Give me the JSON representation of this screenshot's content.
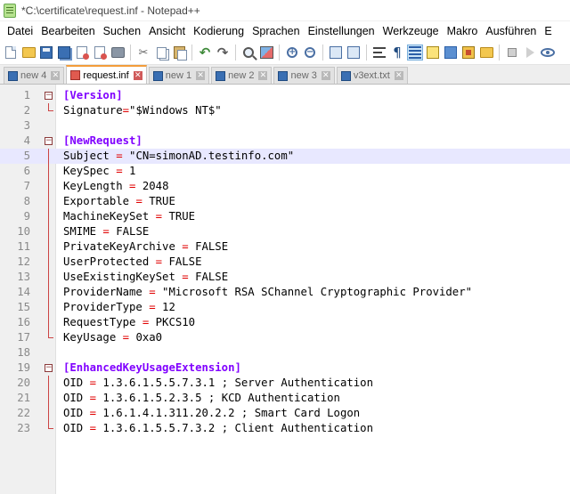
{
  "window": {
    "title": "*C:\\certificate\\request.inf - Notepad++"
  },
  "menu": [
    "Datei",
    "Bearbeiten",
    "Suchen",
    "Ansicht",
    "Kodierung",
    "Sprachen",
    "Einstellungen",
    "Werkzeuge",
    "Makro",
    "Ausführen",
    "E"
  ],
  "toolbar": {
    "icons": [
      "new-file-icon",
      "open-folder-icon",
      "save-icon",
      "save-all-icon",
      "close-icon",
      "close-all-icon",
      "print-icon",
      "cut-icon",
      "copy-icon",
      "paste-icon",
      "undo-icon",
      "redo-icon",
      "find-icon",
      "replace-icon",
      "zoom-in-icon",
      "zoom-out-icon",
      "sync-vertical-icon",
      "sync-horizontal-icon",
      "word-wrap-icon",
      "show-all-characters-icon",
      "indent-guide-icon",
      "user-defined-language-icon",
      "doc-map-icon",
      "function-list-icon",
      "folder-as-workspace-icon",
      "record-macro-icon",
      "play-macro-icon",
      "monitoring-icon"
    ]
  },
  "tabs": [
    {
      "label": "new 4",
      "active": false,
      "modified": false
    },
    {
      "label": "request.inf",
      "active": true,
      "modified": true
    },
    {
      "label": "new 1",
      "active": false,
      "modified": false
    },
    {
      "label": "new 2",
      "active": false,
      "modified": false
    },
    {
      "label": "new 3",
      "active": false,
      "modified": false
    },
    {
      "label": "v3ext.txt",
      "active": false,
      "modified": false
    }
  ],
  "editor": {
    "lines": [
      {
        "num": "1",
        "section": "[Version]"
      },
      {
        "num": "2",
        "key": "Signature",
        "op": "=",
        "val": "\"$Windows NT$\""
      },
      {
        "num": "3"
      },
      {
        "num": "4",
        "section": "[NewRequest]"
      },
      {
        "num": "5",
        "key": "Subject ",
        "op": "=",
        "val": " \"CN=simonAD.testinfo.com\"",
        "current": true
      },
      {
        "num": "6",
        "key": "KeySpec ",
        "op": "=",
        "val": " 1"
      },
      {
        "num": "7",
        "key": "KeyLength ",
        "op": "=",
        "val": " 2048"
      },
      {
        "num": "8",
        "key": "Exportable ",
        "op": "=",
        "val": " TRUE"
      },
      {
        "num": "9",
        "key": "MachineKeySet ",
        "op": "=",
        "val": " TRUE"
      },
      {
        "num": "10",
        "key": "SMIME ",
        "op": "=",
        "val": " FALSE"
      },
      {
        "num": "11",
        "key": "PrivateKeyArchive ",
        "op": "=",
        "val": " FALSE"
      },
      {
        "num": "12",
        "key": "UserProtected ",
        "op": "=",
        "val": " FALSE"
      },
      {
        "num": "13",
        "key": "UseExistingKeySet ",
        "op": "=",
        "val": " FALSE"
      },
      {
        "num": "14",
        "key": "ProviderName ",
        "op": "=",
        "val": " \"Microsoft RSA SChannel Cryptographic Provider\""
      },
      {
        "num": "15",
        "key": "ProviderType ",
        "op": "=",
        "val": " 12"
      },
      {
        "num": "16",
        "key": "RequestType ",
        "op": "=",
        "val": " PKCS10"
      },
      {
        "num": "17",
        "key": "KeyUsage ",
        "op": "=",
        "val": " 0xa0"
      },
      {
        "num": "18"
      },
      {
        "num": "19",
        "section": "[EnhancedKeyUsageExtension]"
      },
      {
        "num": "20",
        "key": "OID ",
        "op": "=",
        "val": " 1.3.6.1.5.5.7.3.1 ; Server Authentication"
      },
      {
        "num": "21",
        "key": "OID ",
        "op": "=",
        "val": " 1.3.6.1.5.2.3.5 ; KCD Authentication"
      },
      {
        "num": "22",
        "key": "OID ",
        "op": "=",
        "val": " 1.6.1.4.1.311.20.2.2 ; Smart Card Logon"
      },
      {
        "num": "23",
        "key": "OID ",
        "op": "=",
        "val": " 1.3.6.1.5.5.7.3.2 ; Client Authentication"
      }
    ]
  },
  "colors": {
    "section": "#8000ff",
    "operator": "#e00000",
    "current_line": "#e8e8ff",
    "fold_margin": "#c44444",
    "active_tab_accent": "#f39c3a"
  }
}
